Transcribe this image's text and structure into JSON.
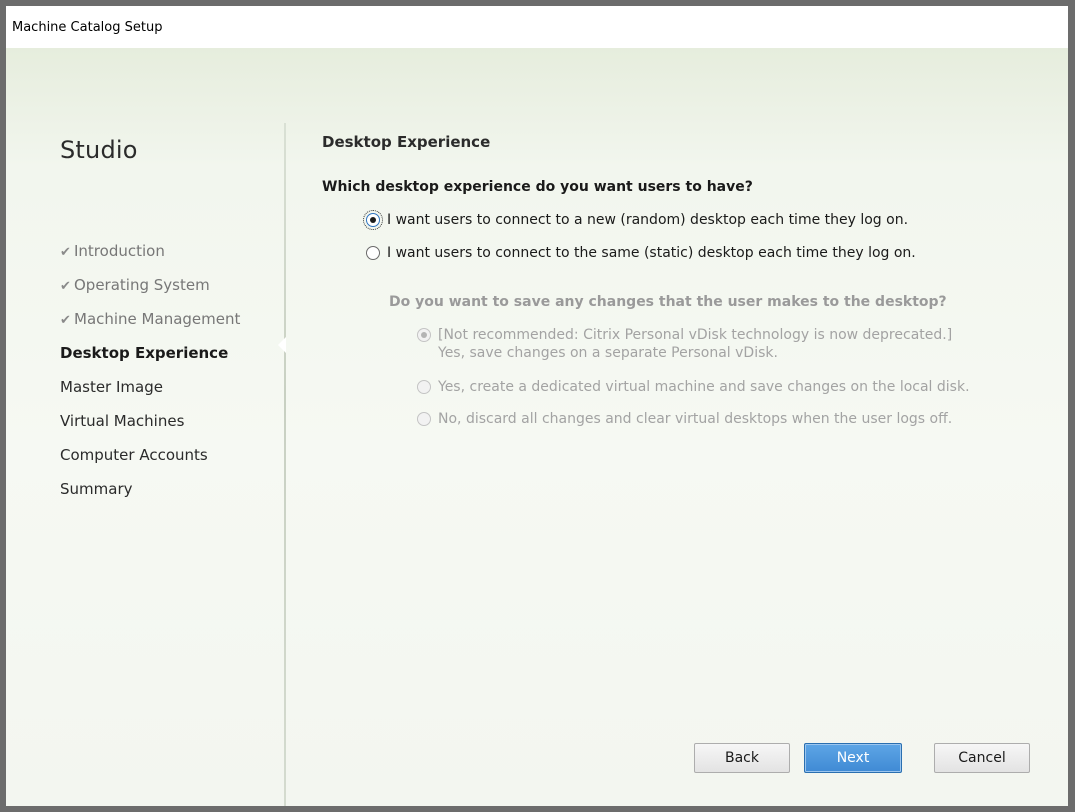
{
  "window": {
    "title": "Machine Catalog Setup"
  },
  "sidebar": {
    "brand": "Studio",
    "items": [
      {
        "label": "Introduction",
        "state": "done"
      },
      {
        "label": "Operating System",
        "state": "done"
      },
      {
        "label": "Machine Management",
        "state": "done"
      },
      {
        "label": "Desktop Experience",
        "state": "current"
      },
      {
        "label": "Master Image",
        "state": "pending"
      },
      {
        "label": "Virtual Machines",
        "state": "pending"
      },
      {
        "label": "Computer Accounts",
        "state": "pending"
      },
      {
        "label": "Summary",
        "state": "pending"
      }
    ]
  },
  "main": {
    "heading": "Desktop Experience",
    "question": "Which desktop experience do you want users to have?",
    "options": [
      {
        "label": "I want users to connect to a new (random) desktop each time they log on.",
        "checked": true
      },
      {
        "label": "I want users to connect to the same (static) desktop each time they log on.",
        "checked": false
      }
    ],
    "sub_question": "Do you want to save any changes that the user makes to the desktop?",
    "sub_options": [
      {
        "line1": "[Not recommended: Citrix Personal vDisk technology is now deprecated.]",
        "line2": "Yes, save changes on a separate Personal vDisk.",
        "checked": true
      },
      {
        "line1": "Yes, create a dedicated virtual machine and save changes on the local disk.",
        "checked": false
      },
      {
        "line1": "No, discard all changes and clear virtual desktops when the user logs off.",
        "checked": false
      }
    ]
  },
  "buttons": {
    "back": "Back",
    "next": "Next",
    "cancel": "Cancel"
  },
  "icons": {
    "check": "checkmark-icon"
  },
  "colors": {
    "accent": "#3f8ad4",
    "background": "#f2f6ee"
  }
}
